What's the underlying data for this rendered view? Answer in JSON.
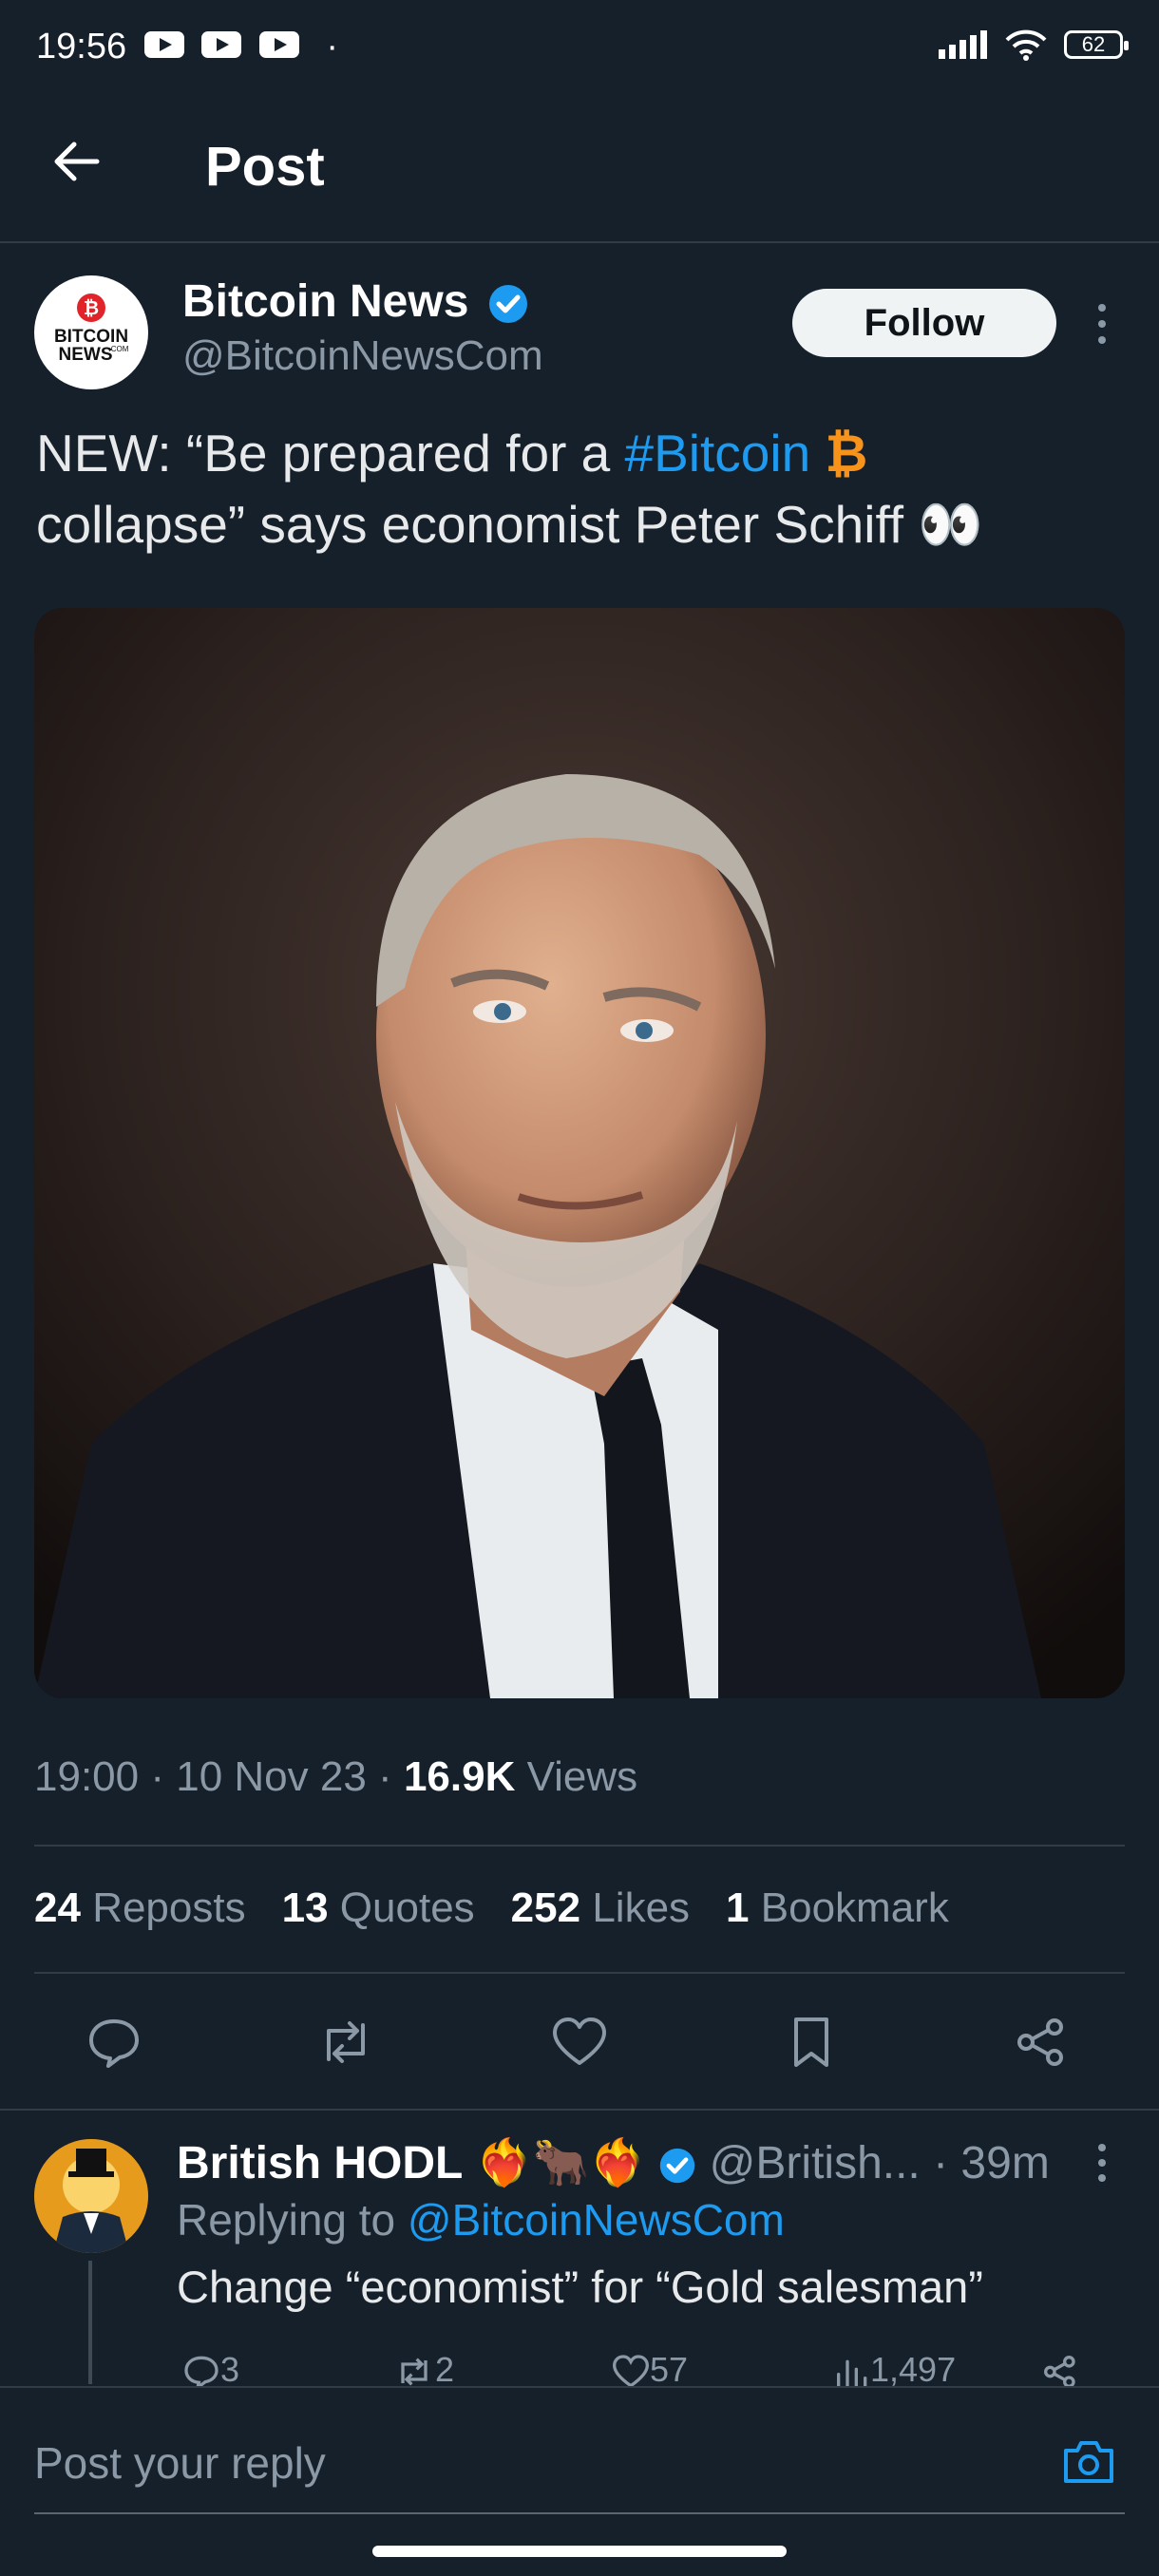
{
  "status_bar": {
    "time": "19:56",
    "dot": "·",
    "battery": "62"
  },
  "header": {
    "title": "Post"
  },
  "post": {
    "author_name": "Bitcoin News",
    "author_handle": "@BitcoinNewsCom",
    "avatar_text_line1": "BITCOIN",
    "avatar_text_line2": "NEWS",
    "avatar_text_small": ".COM",
    "follow_label": "Follow",
    "text_prefix": "NEW: “Be prepared for a ",
    "hashtag": "#Bitcoin",
    "bitcoin_symbol": "₿",
    "text_suffix": "collapse” says economist Peter Schiff",
    "eyes": "👀",
    "time": "19:00",
    "date": "10 Nov 23",
    "views_count": "16.9K",
    "views_label": "Views",
    "separator": "·"
  },
  "stats": [
    {
      "count": "24",
      "label": "Reposts"
    },
    {
      "count": "13",
      "label": "Quotes"
    },
    {
      "count": "252",
      "label": "Likes"
    },
    {
      "count": "1",
      "label": "Bookmark"
    }
  ],
  "reply": {
    "name": "British HODL",
    "emojis": "❤️‍🔥🐂❤️‍🔥",
    "handle": "@British...",
    "time": "· 39m",
    "replying_label": "Replying to",
    "replying_handle": "@BitcoinNewsCom",
    "text": "Change “economist” for “Gold salesman”",
    "replies": "3",
    "reposts": "2",
    "likes": "57",
    "views": "1,497"
  },
  "composer": {
    "placeholder": "Post your reply"
  },
  "colors": {
    "background": "#15202b",
    "accent": "#1d9bf0",
    "bitcoin": "#f7931a"
  }
}
